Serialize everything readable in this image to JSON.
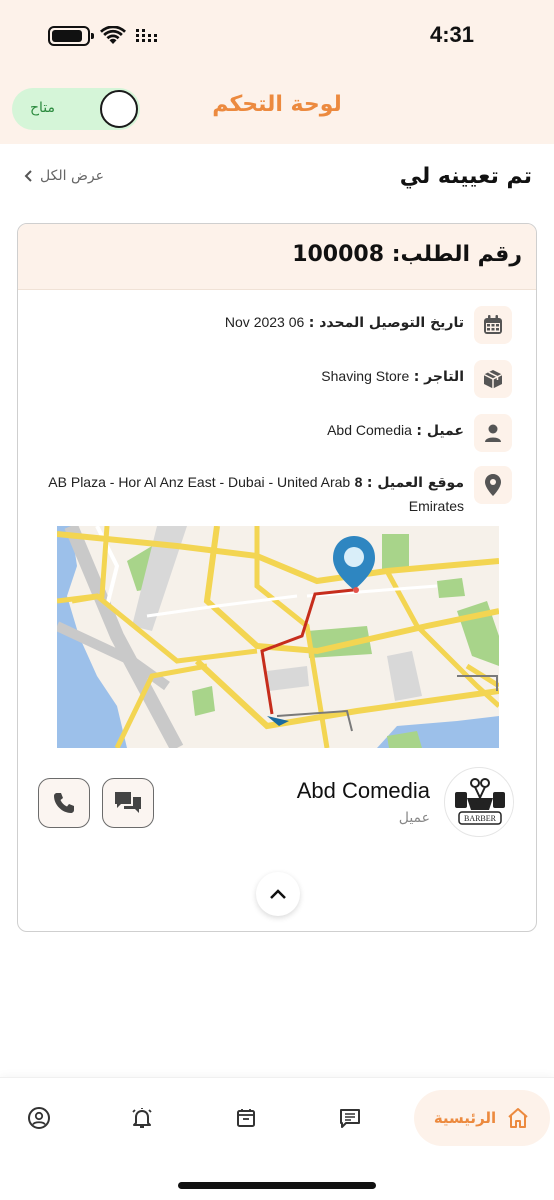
{
  "status_bar": {
    "time": "4:31"
  },
  "header": {
    "title": "لوحة التحكم",
    "availability_label": "متاح",
    "accent_color": "#ec8a3f"
  },
  "section": {
    "title": "تم تعيينه لي",
    "view_all_label": "عرض الكل"
  },
  "order": {
    "number_label": "رقم الطلب: 100008",
    "delivery_date_label": "تاريخ التوصيل المحدد :",
    "delivery_date_value": "06 2023 Nov",
    "merchant_label": "التاجر :",
    "merchant_value": "Shaving Store",
    "customer_label": "عميل :",
    "customer_value": "Abd Comedia",
    "location_label": "موقع العميل :",
    "location_number": "8",
    "location_value": "AB Plaza - Hor Al Anz East - Dubai - United Arab Emirates"
  },
  "customer_card": {
    "name": "Abd Comedia",
    "role": "عميل",
    "avatar_icon": "barber-logo-icon",
    "avatar_text": "BARBER"
  },
  "actions": {
    "chat_icon": "chat-icon",
    "call_icon": "phone-icon",
    "collapse_icon": "chevron-up-icon"
  },
  "bottom_nav": {
    "home_label": "الرئيسية",
    "items": [
      "home-icon",
      "messages-icon",
      "orders-icon",
      "notifications-icon",
      "profile-icon"
    ]
  }
}
